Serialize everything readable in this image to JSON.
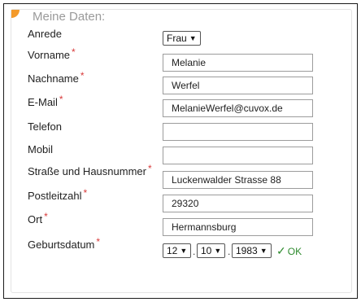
{
  "section": {
    "title": "Meine Daten:"
  },
  "fields": {
    "anrede": {
      "label": "Anrede",
      "value": "Frau"
    },
    "vorname": {
      "label": "Vorname",
      "required_mark": "*",
      "value": "Melanie"
    },
    "nachname": {
      "label": "Nachname",
      "required_mark": "*",
      "value": "Werfel"
    },
    "email": {
      "label": "E-Mail",
      "required_mark": "*",
      "value": "MelanieWerfel@cuvox.de"
    },
    "telefon": {
      "label": "Telefon",
      "value": ""
    },
    "mobil": {
      "label": "Mobil",
      "value": ""
    },
    "strasse": {
      "label": "Straße und Hausnummer",
      "required_mark": "*",
      "value": "Luckenwalder Strasse 88"
    },
    "plz": {
      "label": "Postleitzahl",
      "required_mark": "*",
      "value": "29320"
    },
    "ort": {
      "label": "Ort",
      "required_mark": "*",
      "value": "Hermannsburg"
    },
    "geburtsdatum": {
      "label": "Geburtsdatum",
      "required_mark": "*",
      "day": "12",
      "month": "10",
      "year": "1983",
      "separator": ".",
      "status": "OK"
    }
  },
  "colors": {
    "accent": "#f39a2b",
    "required": "#d83a3a",
    "ok": "#2e8b2e"
  },
  "icons": {
    "select": "chevron-down-icon",
    "valid": "check-icon"
  }
}
